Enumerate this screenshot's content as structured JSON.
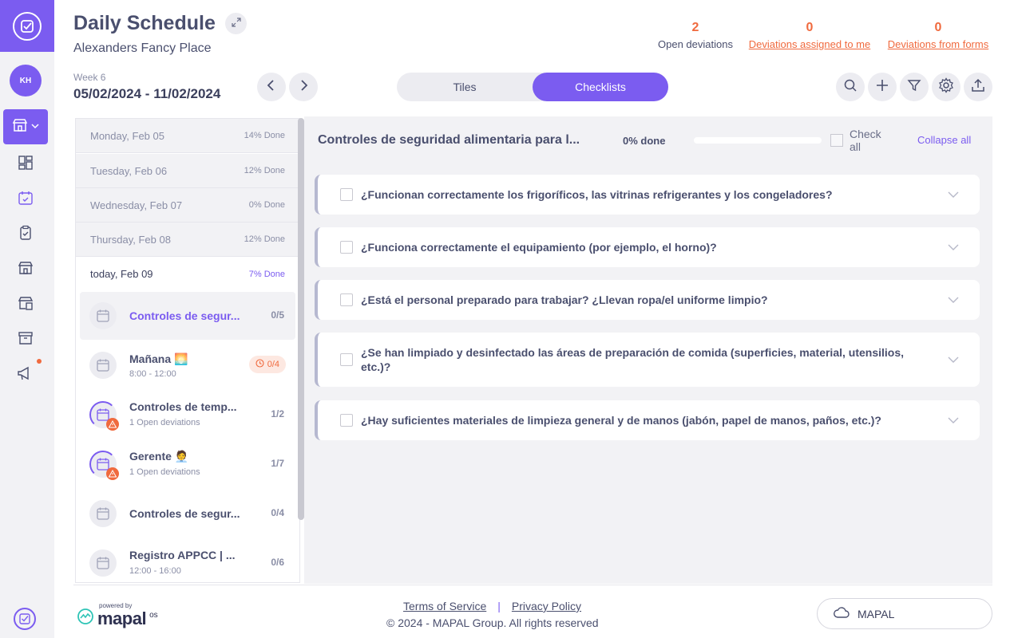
{
  "avatar": {
    "initials": "KH"
  },
  "header": {
    "title": "Daily Schedule",
    "location": "Alexanders Fancy Place",
    "week_label": "Week 6",
    "date_range": "05/02/2024 - 11/02/2024"
  },
  "deviations": {
    "open": {
      "count": "2",
      "label": "Open deviations"
    },
    "assigned": {
      "count": "0",
      "label": "Deviations assigned to me"
    },
    "forms": {
      "count": "0",
      "label": "Deviations from forms"
    }
  },
  "view_toggle": {
    "tiles": "Tiles",
    "checklists": "Checklists",
    "selected": "Checklists"
  },
  "days": [
    {
      "label": "Monday, Feb 05",
      "done": "14% Done"
    },
    {
      "label": "Tuesday, Feb 06",
      "done": "12% Done"
    },
    {
      "label": "Wednesday, Feb 07",
      "done": "0% Done"
    },
    {
      "label": "Thursday, Feb 08",
      "done": "12% Done"
    },
    {
      "label": "today, Feb 09",
      "done": "7% Done"
    }
  ],
  "tasks": [
    {
      "name": "Controles de segur...",
      "sub": "",
      "count": "0/5"
    },
    {
      "name": "Mañana 🌅",
      "sub": "8:00 - 12:00",
      "count": "0/4"
    },
    {
      "name": "Controles de temp...",
      "sub": "1 Open deviations",
      "count": "1/2"
    },
    {
      "name": "Gerente 🧑‍💼",
      "sub": "1 Open deviations",
      "count": "1/7"
    },
    {
      "name": "Controles de segur...",
      "sub": "",
      "count": "0/4"
    },
    {
      "name": "Registro APPCC | ...",
      "sub": "12:00 - 16:00",
      "count": "0/6"
    }
  ],
  "checklist": {
    "title": "Controles de seguridad alimentaria para l...",
    "progress_label": "0% done",
    "progress": 0,
    "check_all": "Check all",
    "collapse_all": "Collapse all",
    "questions": [
      "¿Funcionan correctamente los frigoríficos, las vitrinas refrigerantes y los congeladores?",
      "¿Funciona correctamente el equipamiento (por ejemplo, el horno)?",
      "¿Está el personal preparado para trabajar? ¿Llevan ropa/el uniforme limpio?",
      "¿Se han limpiado y desinfectado las áreas de preparación de comida (superficies, material, utensilios, etc.)?",
      "¿Hay suficientes materiales de limpieza general y de manos (jabón, papel de manos, paños, etc.)?"
    ]
  },
  "footer": {
    "powered_by": "powered by",
    "brand": "mapal",
    "brand_suffix": "os",
    "terms": "Terms of Service",
    "separator": "|",
    "privacy": "Privacy Policy",
    "copyright": "© 2024 - MAPAL Group. All rights reserved",
    "org": "MAPAL"
  },
  "colors": {
    "accent": "#7b5cf0",
    "alert": "#f06a3e",
    "panel_bg": "#f2f2f5"
  },
  "icons": [
    "app-logo-icon",
    "store-icon",
    "dashboard-icon",
    "calendar-check-icon",
    "clipboard-icon",
    "shop-icon",
    "shop-list-icon",
    "archive-icon",
    "megaphone-icon",
    "expand-icon",
    "chevron-left-icon",
    "chevron-right-icon",
    "search-icon",
    "plus-icon",
    "filter-icon",
    "gear-icon",
    "upload-icon",
    "calendar-icon",
    "clock-icon",
    "warning-icon",
    "chevron-down-icon",
    "cloud-icon"
  ]
}
